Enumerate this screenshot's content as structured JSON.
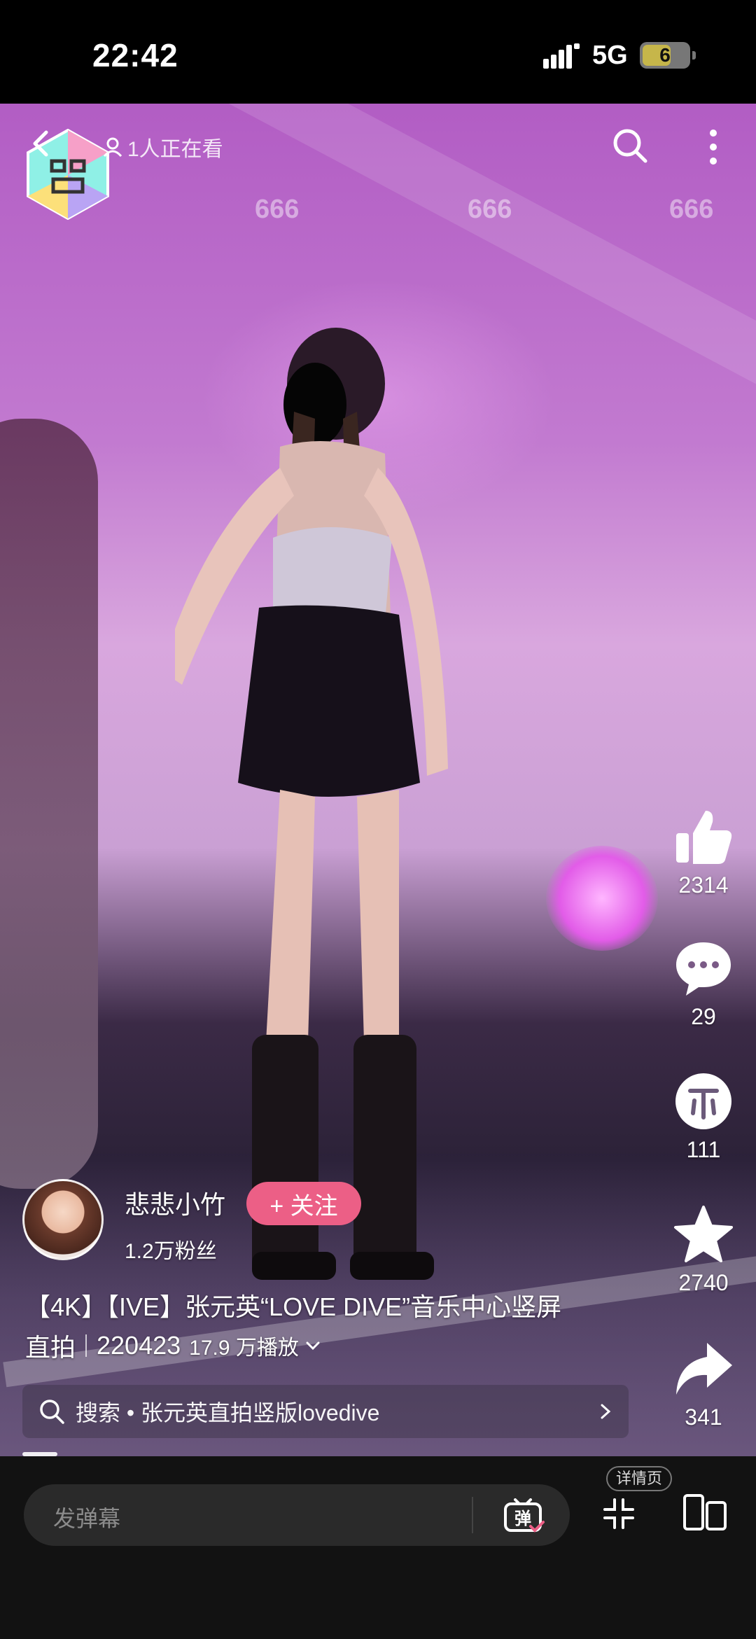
{
  "status_bar": {
    "time": "22:42",
    "network": "5G",
    "battery": "6"
  },
  "video": {
    "danmaku": [
      "666",
      "666",
      "666"
    ],
    "watching": "1人正在看"
  },
  "actions": {
    "likes": "2314",
    "comments": "29",
    "coins": "111",
    "favorites": "2740",
    "shares": "341"
  },
  "author": {
    "name": "悲悲小竹",
    "follow_label": "+ 关注",
    "fans": "1.2万粉丝"
  },
  "description": {
    "title_line1": "【4K】【IVE】张元英“LOVE DIVE”音乐中心竖屏",
    "title_line2": "直拍",
    "date": "220423",
    "plays": "17.9 万播放"
  },
  "search": {
    "text": "搜索 • 张元英直拍竖版lovedive"
  },
  "bottom": {
    "comment_placeholder": "发弹幕",
    "danmaku_button": "弹",
    "detail_tag": "详情页"
  },
  "icons": {
    "back": "back-icon",
    "search": "search-icon",
    "more": "more-icon",
    "like": "thumb-up-icon",
    "comment": "comment-icon",
    "coin": "coin-icon",
    "favorite": "star-icon",
    "share": "share-icon",
    "fullscreen-exit": "collapse-icon",
    "split": "split-screen-icon"
  },
  "colors": {
    "follow": "#ec5f86",
    "bottom_bar": "#121212"
  }
}
